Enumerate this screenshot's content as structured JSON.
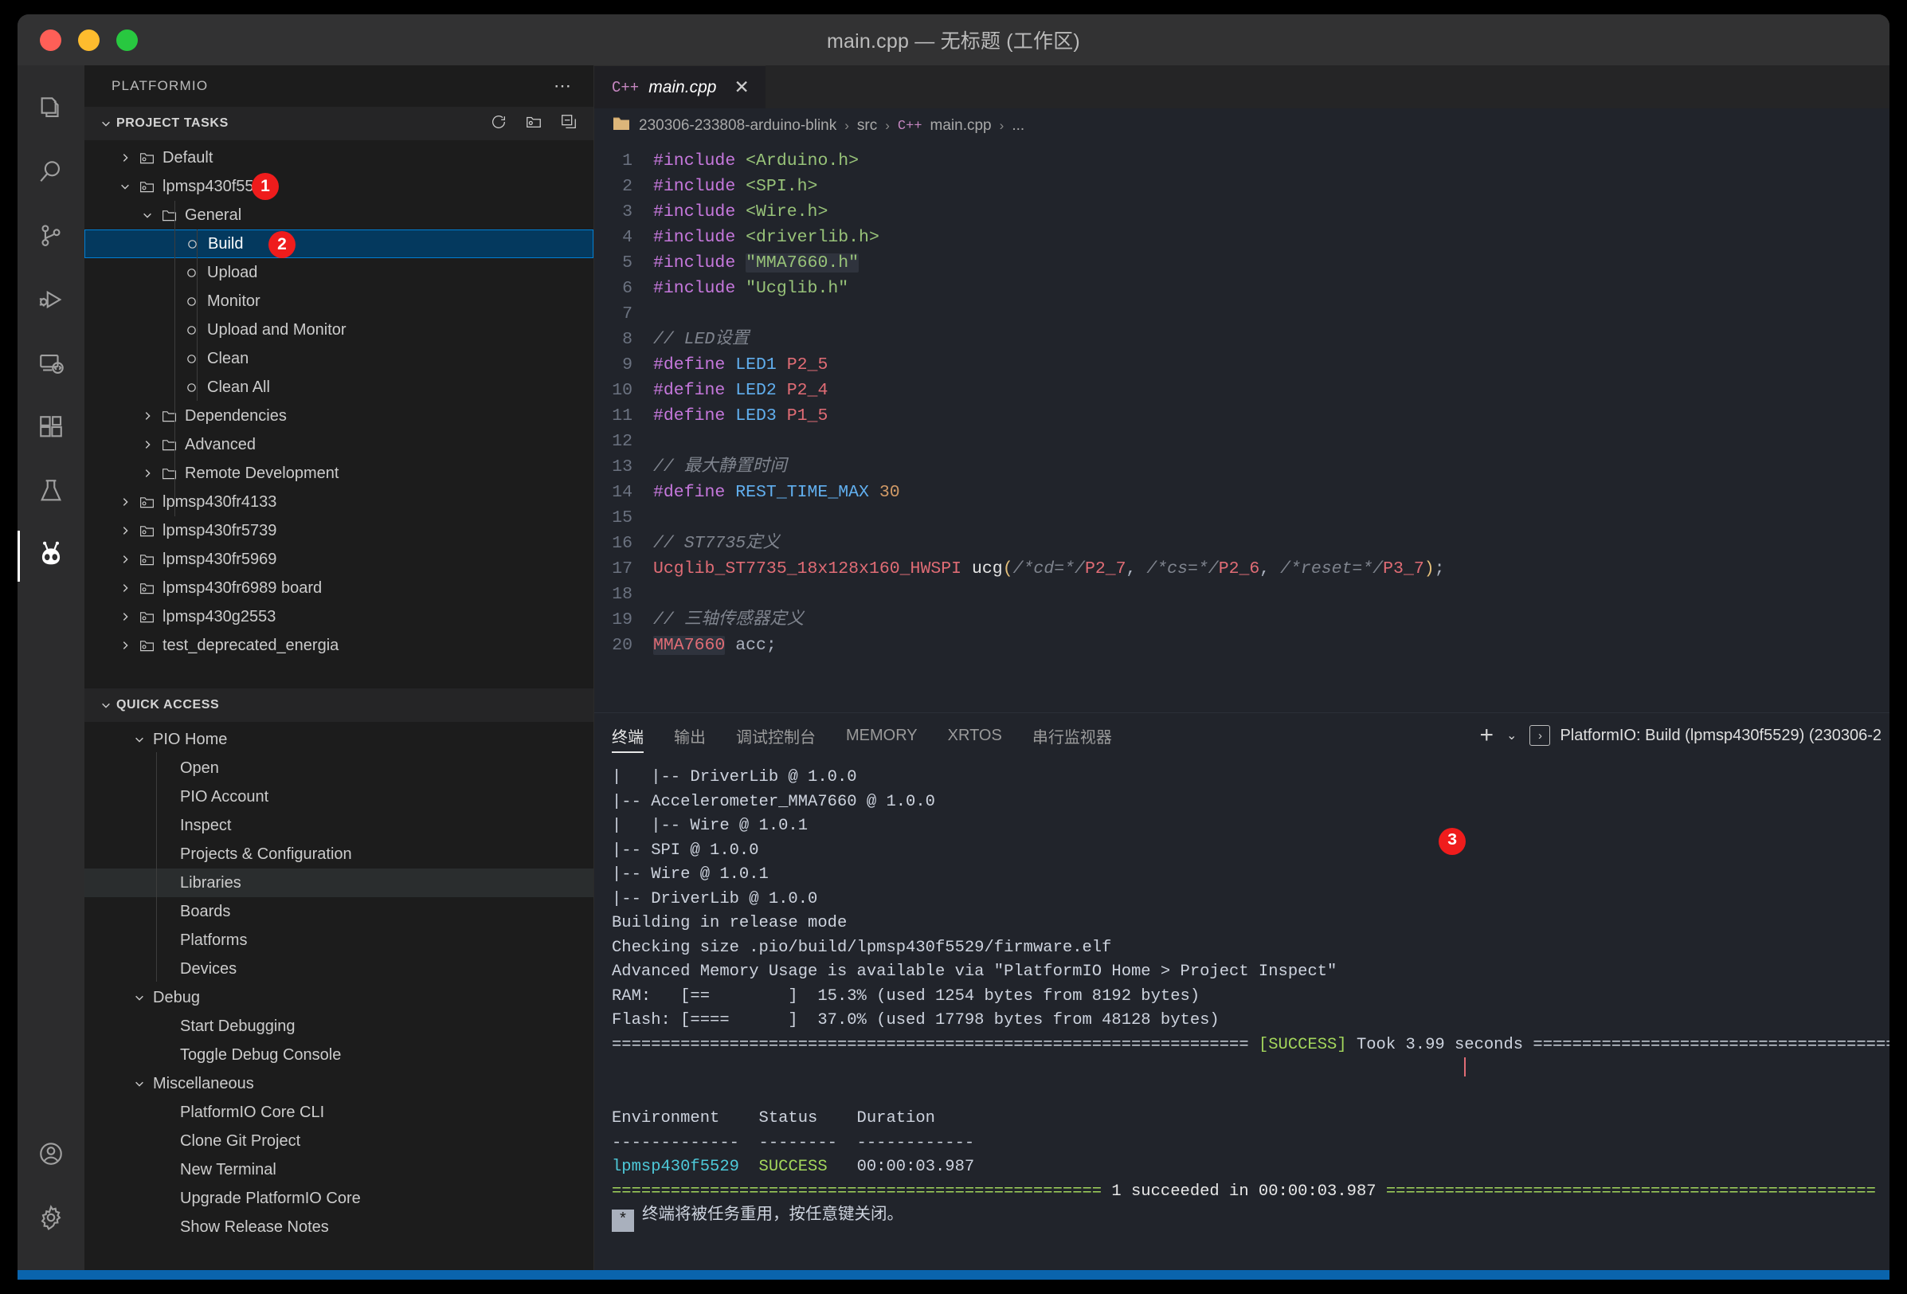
{
  "window": {
    "title": "main.cpp — 无标题 (工作区)",
    "traffic": [
      "close",
      "minimize",
      "maximize"
    ]
  },
  "activitybar": {
    "items": [
      {
        "name": "explorer",
        "icon": "files-icon"
      },
      {
        "name": "search",
        "icon": "search-icon"
      },
      {
        "name": "source-control",
        "icon": "source-control-icon"
      },
      {
        "name": "run-and-debug",
        "icon": "run-debug-icon"
      },
      {
        "name": "remote-explorer",
        "icon": "remote-explorer-icon"
      },
      {
        "name": "extensions",
        "icon": "extensions-icon"
      },
      {
        "name": "testing",
        "icon": "beaker-icon"
      },
      {
        "name": "platformio",
        "icon": "platformio-alien-icon"
      }
    ],
    "bottom": [
      {
        "name": "accounts",
        "icon": "account-icon"
      },
      {
        "name": "settings",
        "icon": "gear-icon"
      }
    ]
  },
  "sidebar": {
    "title": "PLATFORMIO",
    "overflow_icon": "ellipsis-icon",
    "project_tasks": {
      "header": "PROJECT TASKS",
      "actions": [
        "refresh-icon",
        "new-folder-icon",
        "collapse-all-icon"
      ],
      "items": [
        {
          "label": "Default",
          "level": 1,
          "arrow": "right",
          "icon": "env-icon"
        },
        {
          "label": "lpmsp430f5529",
          "level": 1,
          "arrow": "down",
          "icon": "env-icon",
          "badge": "1"
        },
        {
          "label": "General",
          "level": 2,
          "arrow": "down",
          "icon": "folder-icon"
        },
        {
          "label": "Build",
          "level": 3,
          "arrow": "",
          "icon": "task-icon",
          "selected": true,
          "badge": "2"
        },
        {
          "label": "Upload",
          "level": 3,
          "arrow": "",
          "icon": "task-icon"
        },
        {
          "label": "Monitor",
          "level": 3,
          "arrow": "",
          "icon": "task-icon"
        },
        {
          "label": "Upload and Monitor",
          "level": 3,
          "arrow": "",
          "icon": "task-icon"
        },
        {
          "label": "Clean",
          "level": 3,
          "arrow": "",
          "icon": "task-icon"
        },
        {
          "label": "Clean All",
          "level": 3,
          "arrow": "",
          "icon": "task-icon"
        },
        {
          "label": "Dependencies",
          "level": 2,
          "arrow": "right",
          "icon": "folder-icon"
        },
        {
          "label": "Advanced",
          "level": 2,
          "arrow": "right",
          "icon": "folder-icon"
        },
        {
          "label": "Remote Development",
          "level": 2,
          "arrow": "right",
          "icon": "folder-icon"
        },
        {
          "label": "lpmsp430fr4133",
          "level": 1,
          "arrow": "right",
          "icon": "env-icon"
        },
        {
          "label": "lpmsp430fr5739",
          "level": 1,
          "arrow": "right",
          "icon": "env-icon"
        },
        {
          "label": "lpmsp430fr5969",
          "level": 1,
          "arrow": "right",
          "icon": "env-icon"
        },
        {
          "label": "lpmsp430fr6989 board",
          "level": 1,
          "arrow": "right",
          "icon": "env-icon"
        },
        {
          "label": "lpmsp430g2553",
          "level": 1,
          "arrow": "right",
          "icon": "env-icon"
        },
        {
          "label": "test_deprecated_energia",
          "level": 1,
          "arrow": "right",
          "icon": "env-icon"
        }
      ]
    },
    "quick_access": {
      "header": "QUICK ACCESS",
      "items": [
        {
          "label": "PIO Home",
          "level": 1,
          "arrow": "down"
        },
        {
          "label": "Open",
          "level": 2,
          "arrow": ""
        },
        {
          "label": "PIO Account",
          "level": 2,
          "arrow": ""
        },
        {
          "label": "Inspect",
          "level": 2,
          "arrow": ""
        },
        {
          "label": "Projects & Configuration",
          "level": 2,
          "arrow": ""
        },
        {
          "label": "Libraries",
          "level": 2,
          "arrow": "",
          "hovered": true
        },
        {
          "label": "Boards",
          "level": 2,
          "arrow": ""
        },
        {
          "label": "Platforms",
          "level": 2,
          "arrow": ""
        },
        {
          "label": "Devices",
          "level": 2,
          "arrow": ""
        },
        {
          "label": "Debug",
          "level": 1,
          "arrow": "down"
        },
        {
          "label": "Start Debugging",
          "level": 2,
          "arrow": ""
        },
        {
          "label": "Toggle Debug Console",
          "level": 2,
          "arrow": ""
        },
        {
          "label": "Miscellaneous",
          "level": 1,
          "arrow": "down"
        },
        {
          "label": "PlatformIO Core CLI",
          "level": 2,
          "arrow": ""
        },
        {
          "label": "Clone Git Project",
          "level": 2,
          "arrow": ""
        },
        {
          "label": "New Terminal",
          "level": 2,
          "arrow": ""
        },
        {
          "label": "Upgrade PlatformIO Core",
          "level": 2,
          "arrow": ""
        },
        {
          "label": "Show Release Notes",
          "level": 2,
          "arrow": ""
        }
      ]
    }
  },
  "editor": {
    "tab": {
      "label": "main.cpp",
      "lang_icon": "C++",
      "close_icon": "close-icon"
    },
    "breadcrumb": [
      "230306-233808-arduino-blink",
      "src",
      "main.cpp",
      "..."
    ],
    "lines": [
      {
        "n": "1",
        "segs": [
          {
            "t": "#include ",
            "c": "k-pre"
          },
          {
            "t": "<Arduino.h>",
            "c": "k-str"
          }
        ]
      },
      {
        "n": "2",
        "segs": [
          {
            "t": "#include ",
            "c": "k-pre"
          },
          {
            "t": "<SPI.h>",
            "c": "k-str"
          }
        ]
      },
      {
        "n": "3",
        "segs": [
          {
            "t": "#include ",
            "c": "k-pre"
          },
          {
            "t": "<Wire.h>",
            "c": "k-str"
          }
        ]
      },
      {
        "n": "4",
        "segs": [
          {
            "t": "#include ",
            "c": "k-pre"
          },
          {
            "t": "<driverlib.h>",
            "c": "k-str"
          }
        ]
      },
      {
        "n": "5",
        "segs": [
          {
            "t": "#include ",
            "c": "k-pre"
          },
          {
            "t": "\"MMA7660.h\"",
            "c": "k-str hl-occ"
          }
        ]
      },
      {
        "n": "6",
        "segs": [
          {
            "t": "#include ",
            "c": "k-pre"
          },
          {
            "t": "\"Ucglib.h\"",
            "c": "k-str"
          }
        ]
      },
      {
        "n": "7",
        "segs": []
      },
      {
        "n": "8",
        "segs": [
          {
            "t": "// LED设置",
            "c": "k-cmt"
          }
        ]
      },
      {
        "n": "9",
        "segs": [
          {
            "t": "#define ",
            "c": "k-pre"
          },
          {
            "t": "LED1",
            "c": "k-id"
          },
          {
            "t": " ",
            "c": ""
          },
          {
            "t": "P2_5",
            "c": "k-const"
          }
        ]
      },
      {
        "n": "10",
        "segs": [
          {
            "t": "#define ",
            "c": "k-pre"
          },
          {
            "t": "LED2",
            "c": "k-id"
          },
          {
            "t": " ",
            "c": ""
          },
          {
            "t": "P2_4",
            "c": "k-const"
          }
        ]
      },
      {
        "n": "11",
        "segs": [
          {
            "t": "#define ",
            "c": "k-pre"
          },
          {
            "t": "LED3",
            "c": "k-id"
          },
          {
            "t": " ",
            "c": ""
          },
          {
            "t": "P1_5",
            "c": "k-const"
          }
        ]
      },
      {
        "n": "12",
        "segs": []
      },
      {
        "n": "13",
        "segs": [
          {
            "t": "// 最大静置时间",
            "c": "k-cmt"
          }
        ]
      },
      {
        "n": "14",
        "segs": [
          {
            "t": "#define ",
            "c": "k-pre"
          },
          {
            "t": "REST_TIME_MAX",
            "c": "k-id"
          },
          {
            "t": " ",
            "c": ""
          },
          {
            "t": "30",
            "c": "k-num"
          }
        ]
      },
      {
        "n": "15",
        "segs": []
      },
      {
        "n": "16",
        "segs": [
          {
            "t": "// ST7735定义",
            "c": "k-cmt"
          }
        ]
      },
      {
        "n": "17",
        "segs": [
          {
            "t": "Ucglib_ST7735_18x128x160_HWSPI",
            "c": "k-type"
          },
          {
            "t": " ",
            "c": ""
          },
          {
            "t": "ucg",
            "c": "k-fn"
          },
          {
            "t": "(",
            "c": "k-paren"
          },
          {
            "t": "/*cd=*/",
            "c": "k-cmt"
          },
          {
            "t": "P2_7",
            "c": "k-const"
          },
          {
            "t": ", ",
            "c": "k-punc"
          },
          {
            "t": "/*cs=*/",
            "c": "k-cmt"
          },
          {
            "t": "P2_6",
            "c": "k-const"
          },
          {
            "t": ", ",
            "c": "k-punc"
          },
          {
            "t": "/*reset=*/",
            "c": "k-cmt"
          },
          {
            "t": "P3_7",
            "c": "k-const"
          },
          {
            "t": ")",
            "c": "k-paren"
          },
          {
            "t": ";",
            "c": "k-punc"
          }
        ]
      },
      {
        "n": "18",
        "segs": []
      },
      {
        "n": "19",
        "segs": [
          {
            "t": "// 三轴传感器定义",
            "c": "k-cmt"
          }
        ]
      },
      {
        "n": "20",
        "segs": [
          {
            "t": "MMA7660",
            "c": "k-type hl-occ"
          },
          {
            "t": " acc;",
            "c": "k-punc"
          }
        ]
      }
    ]
  },
  "panel": {
    "tabs": [
      {
        "label": "终端",
        "active": true
      },
      {
        "label": "输出",
        "active": false
      },
      {
        "label": "调试控制台",
        "active": false
      },
      {
        "label": "MEMORY",
        "active": false
      },
      {
        "label": "XRTOS",
        "active": false
      },
      {
        "label": "串行监视器",
        "active": false
      }
    ],
    "add_icon": "plus-icon",
    "add_caret_icon": "chevron-down-icon",
    "active_terminal": "PlatformIO: Build (lpmsp430f5529) (230306-2",
    "terminal_icon": "terminal-chevron-icon",
    "output": [
      [
        {
          "t": "|   |-- DriverLib @ 1.0.0"
        }
      ],
      [
        {
          "t": "|-- Accelerometer_MMA7660 @ 1.0.0"
        }
      ],
      [
        {
          "t": "|   |-- Wire @ 1.0.1"
        }
      ],
      [
        {
          "t": "|-- SPI @ 1.0.0"
        }
      ],
      [
        {
          "t": "|-- Wire @ 1.0.1"
        }
      ],
      [
        {
          "t": "|-- DriverLib @ 1.0.0"
        }
      ],
      [
        {
          "t": "Building in release mode"
        }
      ],
      [
        {
          "t": "Checking size .pio/build/lpmsp430f5529/firmware.elf"
        }
      ],
      [
        {
          "t": "Advanced Memory Usage is available via \"PlatformIO Home > Project Inspect\""
        }
      ],
      [
        {
          "t": "RAM:   [==        ]  15.3% (used 1254 bytes from 8192 bytes)"
        }
      ],
      [
        {
          "t": "Flash: [====      ]  37.0% (used 17798 bytes from 48128 bytes)"
        }
      ],
      [
        {
          "t": "================================================================= "
        },
        {
          "t": "[SUCCESS]",
          "c": "t-green"
        },
        {
          "t": " Took 3.99 seconds ================================================================="
        }
      ],
      [
        {
          "t": "",
          "cursor": true
        }
      ],
      [
        {
          "t": ""
        }
      ],
      [
        {
          "t": "Environment    Status    Duration"
        }
      ],
      [
        {
          "t": "-------------  --------  ------------"
        }
      ],
      [
        {
          "t": "lpmsp430f5529",
          "c": "t-cyan"
        },
        {
          "t": "  "
        },
        {
          "t": "SUCCESS",
          "c": "t-green"
        },
        {
          "t": "   00:00:03.987"
        }
      ],
      [
        {
          "t": "================================================== ",
          "c": "t-green"
        },
        {
          "t": "1 succeeded in 00:00:03.987",
          "c": "t-white"
        },
        {
          "t": " ==================================================",
          "c": "t-green"
        }
      ],
      [
        {
          "t": "终端将被任务重用，按任意键关闭。",
          "star": true
        }
      ]
    ],
    "badge": "3"
  },
  "colors": {
    "accent_selection": "#04395e",
    "accent_border": "#007fd4",
    "badge_red": "#ef1c1c",
    "success_green": "#a3d65c",
    "statusbar_blue": "#0a64ad"
  }
}
